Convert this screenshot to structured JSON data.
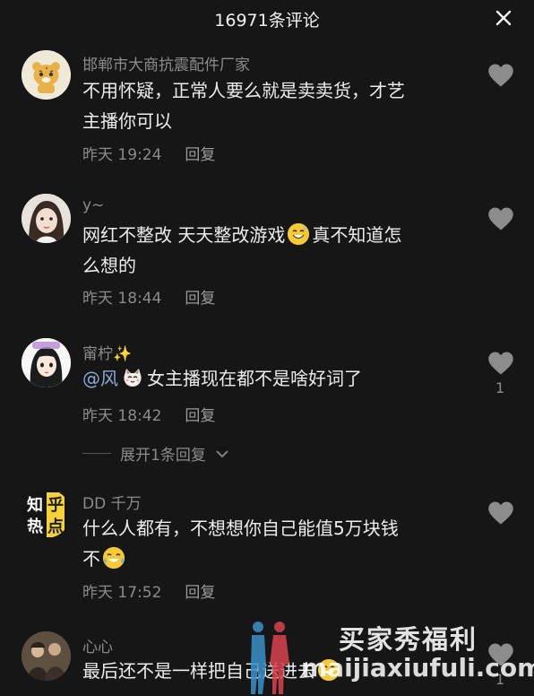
{
  "header": {
    "title": "16971条评论",
    "close_icon": "close-icon"
  },
  "comments": [
    {
      "user": "邯郸市大商抗震配件厂家",
      "text_line1": "不用怀疑，正常人要么就是卖卖货，才艺",
      "text_line2": "主播你可以",
      "time": "昨天 19:24",
      "reply": "回复",
      "avatar_icon": "tiger-avatar"
    },
    {
      "user": "y~",
      "text_a": "网红不整改 天天整改游戏",
      "text_b": "真不知道怎",
      "text_line2": "么想的",
      "emoji": "sweat-smile-emoji",
      "time": "昨天 18:44",
      "reply": "回复",
      "avatar_icon": "girl-avatar"
    },
    {
      "user": "甯柠✨",
      "mention": "@风",
      "text": "女主播现在都不是啥好词了",
      "emoji": "cat-emoji",
      "time": "昨天 18:42",
      "reply": "回复",
      "likes": "1",
      "avatar_icon": "anime-girl-avatar"
    },
    {
      "user": "DD 千万",
      "text_line1": "什么人都有，不想想你自己能值5万块钱",
      "text_line2": "不",
      "emoji": "tears-of-joy-emoji",
      "time": "昨天 17:52",
      "reply": "回复",
      "avatar_text_1": "知",
      "avatar_text_2": "乎",
      "avatar_text_3": "热",
      "avatar_text_4": "点"
    },
    {
      "user": "心心",
      "text": "最后还不是一样把自己送进去",
      "emoji": "sweat-smile-emoji",
      "likes": "1",
      "avatar_icon": "group-photo-avatar"
    }
  ],
  "expand_replies": "展开1条回复",
  "watermark": {
    "title": "买家秀福利",
    "url": "maijiaxiufuli.com"
  },
  "colors": {
    "background": "#161616",
    "secondary_text": "#8b8b8b",
    "primary_text": "#ececec",
    "mention": "#8aa8d6"
  }
}
